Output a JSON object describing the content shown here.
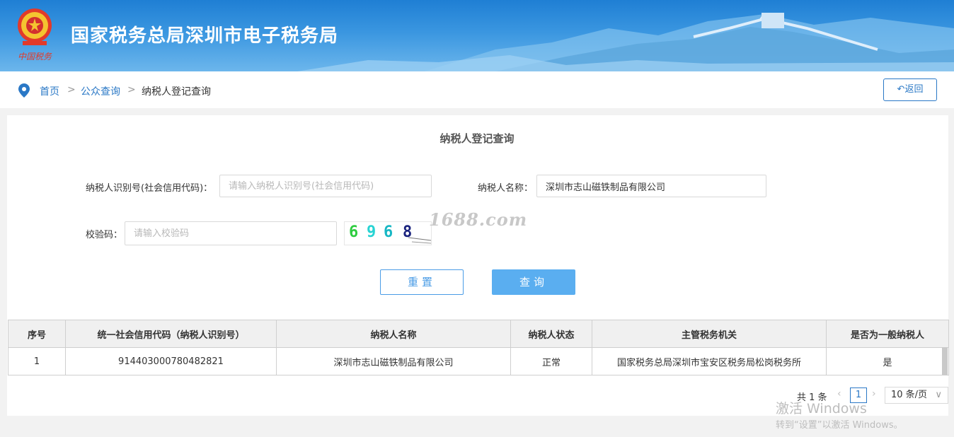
{
  "header": {
    "title": "国家税务总局深圳市电子税务局",
    "emblem_caption": "中国税务"
  },
  "breadcrumb": {
    "items": [
      "首页",
      "公众查询",
      "纳税人登记查询"
    ],
    "separator": ">"
  },
  "back_button": {
    "label": "返回",
    "icon": "return-arrow-icon"
  },
  "form": {
    "title": "纳税人登记查询",
    "taxpayer_id_label": "纳税人识别号(社会信用代码)：",
    "taxpayer_id_placeholder": "请输入纳税人识别号(社会信用代码)",
    "taxpayer_id_value": "",
    "taxpayer_name_label": "纳税人名称：",
    "taxpayer_name_value": "深圳市志山磁铁制品有限公司",
    "captcha_label": "校验码：",
    "captcha_placeholder": "请输入校验码",
    "captcha_digits": [
      "6",
      "9",
      "6",
      "8"
    ],
    "captcha_colors": [
      "#2ecc40",
      "#27d3d3",
      "#18b7c4",
      "#1a237e"
    ],
    "reset_label": "重置",
    "query_label": "查询"
  },
  "watermark_text": "1688.com",
  "table": {
    "headers": [
      "序号",
      "统一社会信用代码（纳税人识别号）",
      "纳税人名称",
      "纳税人状态",
      "主管税务机关",
      "是否为一般纳税人"
    ],
    "rows": [
      [
        "1",
        "914403000780482821",
        "深圳市志山磁铁制品有限公司",
        "正常",
        "国家税务总局深圳市宝安区税务局松岗税务所",
        "是"
      ]
    ]
  },
  "pagination": {
    "total": "共 1 条",
    "current_page": "1",
    "page_size": "10 条/页"
  },
  "windows_watermark": {
    "line1": "激活 Windows",
    "line2": "转到“设置”以激活 Windows。"
  },
  "colors": {
    "brand_blue": "#2a78c6",
    "query_button": "#5aaef0",
    "banner_top": "#1f7fd4"
  }
}
